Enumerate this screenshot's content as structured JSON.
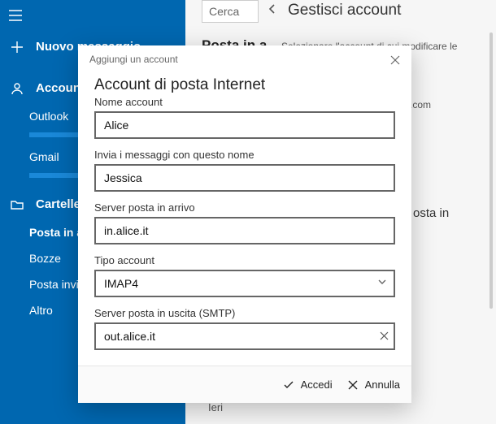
{
  "sidebar": {
    "new_message": "Nuovo messaggio",
    "accounts_label": "Account",
    "accounts": [
      "Outlook",
      "Gmail"
    ],
    "folders_label": "Cartelle",
    "folders": [
      "Posta in a",
      "Bozze",
      "Posta invia",
      "Altro"
    ]
  },
  "right": {
    "search_placeholder": "Cerca",
    "inbox_title": "Posta in a",
    "manage_title": "Gestisci account",
    "manage_sub": "Selezionare l'account di cui modificare le",
    "outlook_addr": "k.com",
    "posta_in": "osta in",
    "ieri": "Ieri"
  },
  "dialog": {
    "title": "Aggiungi un account",
    "heading": "Account di posta Internet",
    "labels": {
      "account_name": "Nome account",
      "send_name": "Invia i messaggi con questo nome",
      "incoming": "Server posta in arrivo",
      "type": "Tipo account",
      "outgoing": "Server posta in uscita (SMTP)"
    },
    "values": {
      "account_name": "Alice",
      "send_name": "Jessica",
      "incoming": "in.alice.it",
      "type": "IMAP4",
      "outgoing": "out.alice.it"
    },
    "footer": {
      "signin": "Accedi",
      "cancel": "Annulla"
    }
  }
}
